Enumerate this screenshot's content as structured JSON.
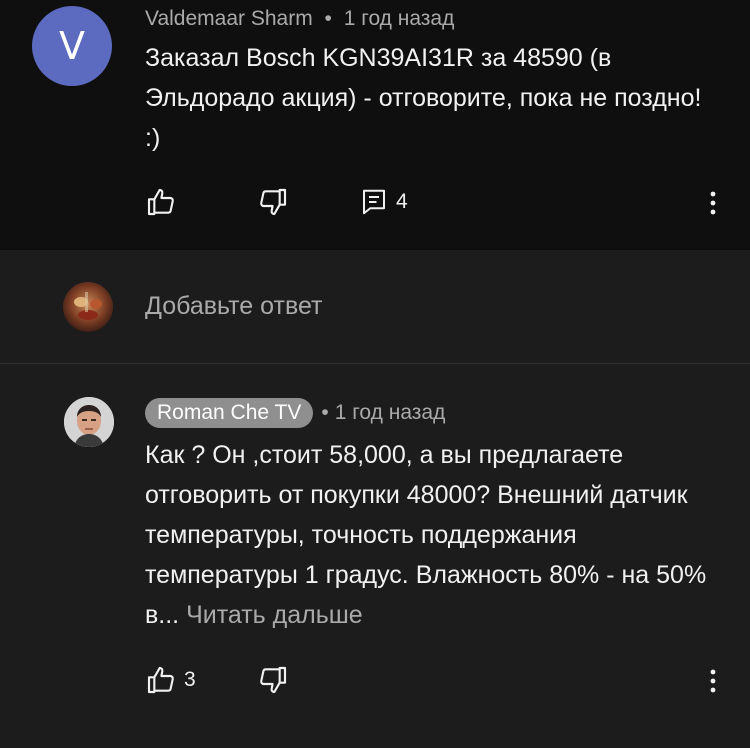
{
  "top_comment": {
    "avatar_letter": "V",
    "author": "Valdemaar Sharm",
    "separator": "•",
    "time": "1 год назад",
    "text": "Заказал Bosch KGN39AI31R за 48590 (в Эльдорадо акция) - отговорите, пока не поздно! :)",
    "replies_count": "4",
    "icons": [
      "like-icon",
      "dislike-icon",
      "reply-icon",
      "more-vert-icon"
    ],
    "avatar_color": "#5c6bc0"
  },
  "reply_input": {
    "placeholder": "Добавьте ответ"
  },
  "reply_comment": {
    "author": "Roman Che TV",
    "separator": "•",
    "time": "1 год назад",
    "text": "Как ? Он ,стоит 58,000, а вы предлагаете отговорить от покупки 48000?  Внешний датчик температуры, точность поддержания температуры 1 градус. Влажность 80% - на 50% в...",
    "read_more": "Читать дальше",
    "likes_count": "3",
    "icons": [
      "like-icon",
      "dislike-icon",
      "more-vert-icon"
    ],
    "chip_color": "#8f8f8f"
  }
}
